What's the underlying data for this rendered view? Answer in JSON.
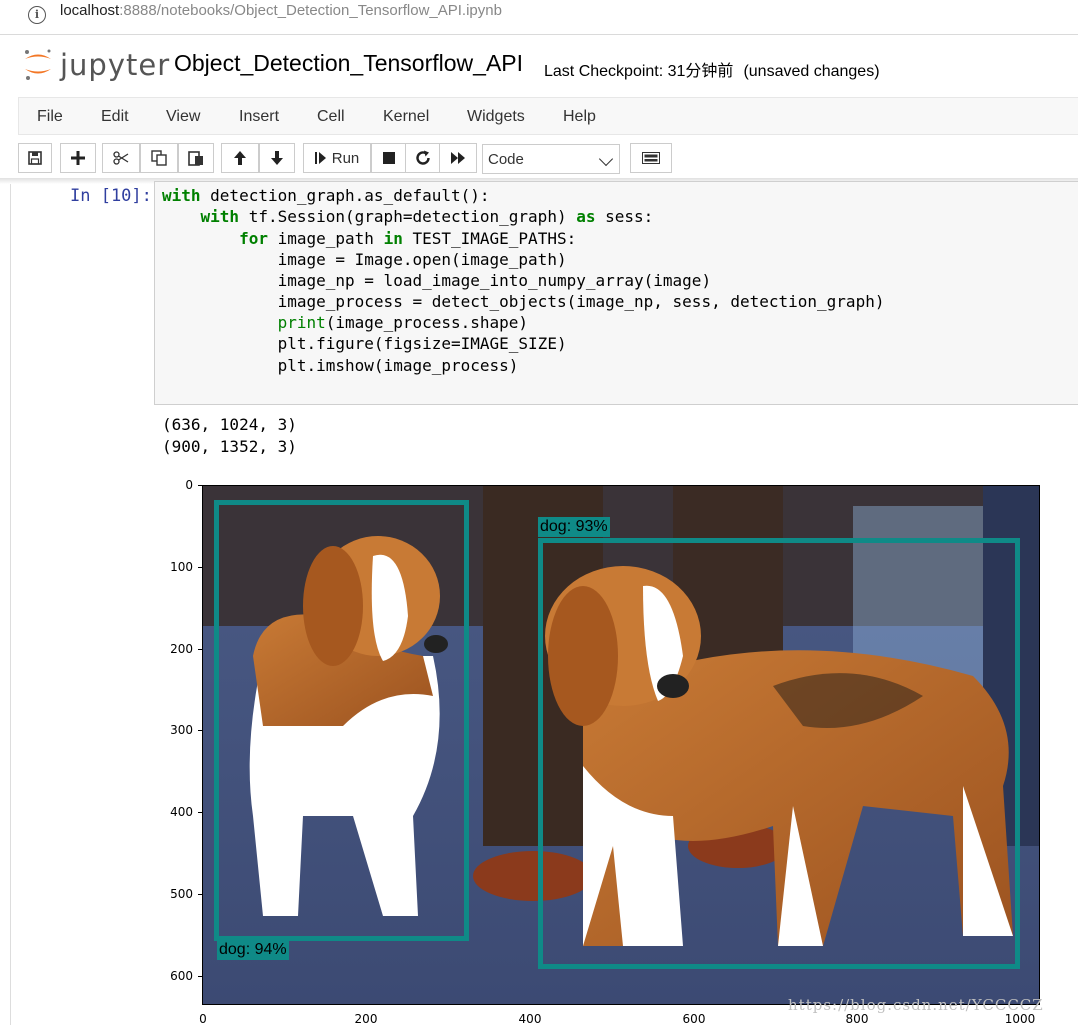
{
  "browser": {
    "url_host": "localhost",
    "url_path": ":8888/notebooks/Object_Detection_Tensorflow_API.ipynb"
  },
  "header": {
    "logo_text": "jupyter",
    "notebook_name": "Object_Detection_Tensorflow_API",
    "checkpoint": "Last Checkpoint: 31分钟前",
    "unsaved": "(unsaved changes)"
  },
  "menu": [
    "File",
    "Edit",
    "View",
    "Insert",
    "Cell",
    "Kernel",
    "Widgets",
    "Help"
  ],
  "toolbar": {
    "run_label": "Run",
    "cell_type": "Code",
    "icons": [
      "save-icon",
      "plus-icon",
      "cut-icon",
      "copy-icon",
      "paste-icon",
      "arrow-up-icon",
      "arrow-down-icon",
      "run-icon",
      "stop-icon",
      "restart-icon",
      "fast-forward-icon",
      "keyboard-icon"
    ]
  },
  "cell": {
    "prompt": "In [10]:",
    "outputs": [
      "(636, 1024, 3)",
      "(900, 1352, 3)"
    ]
  },
  "plot": {
    "y_ticks": [
      "0",
      "100",
      "200",
      "300",
      "400",
      "500",
      "600"
    ],
    "x_ticks": [
      "0",
      "200",
      "400",
      "600",
      "800",
      "1000"
    ],
    "detections": [
      {
        "label": "dog: 94%",
        "score": 0.94
      },
      {
        "label": "dog: 93%",
        "score": 0.93
      }
    ],
    "box_color": "#0f8a87"
  },
  "watermark": "https://blog.csdn.net/YCCCCZ"
}
